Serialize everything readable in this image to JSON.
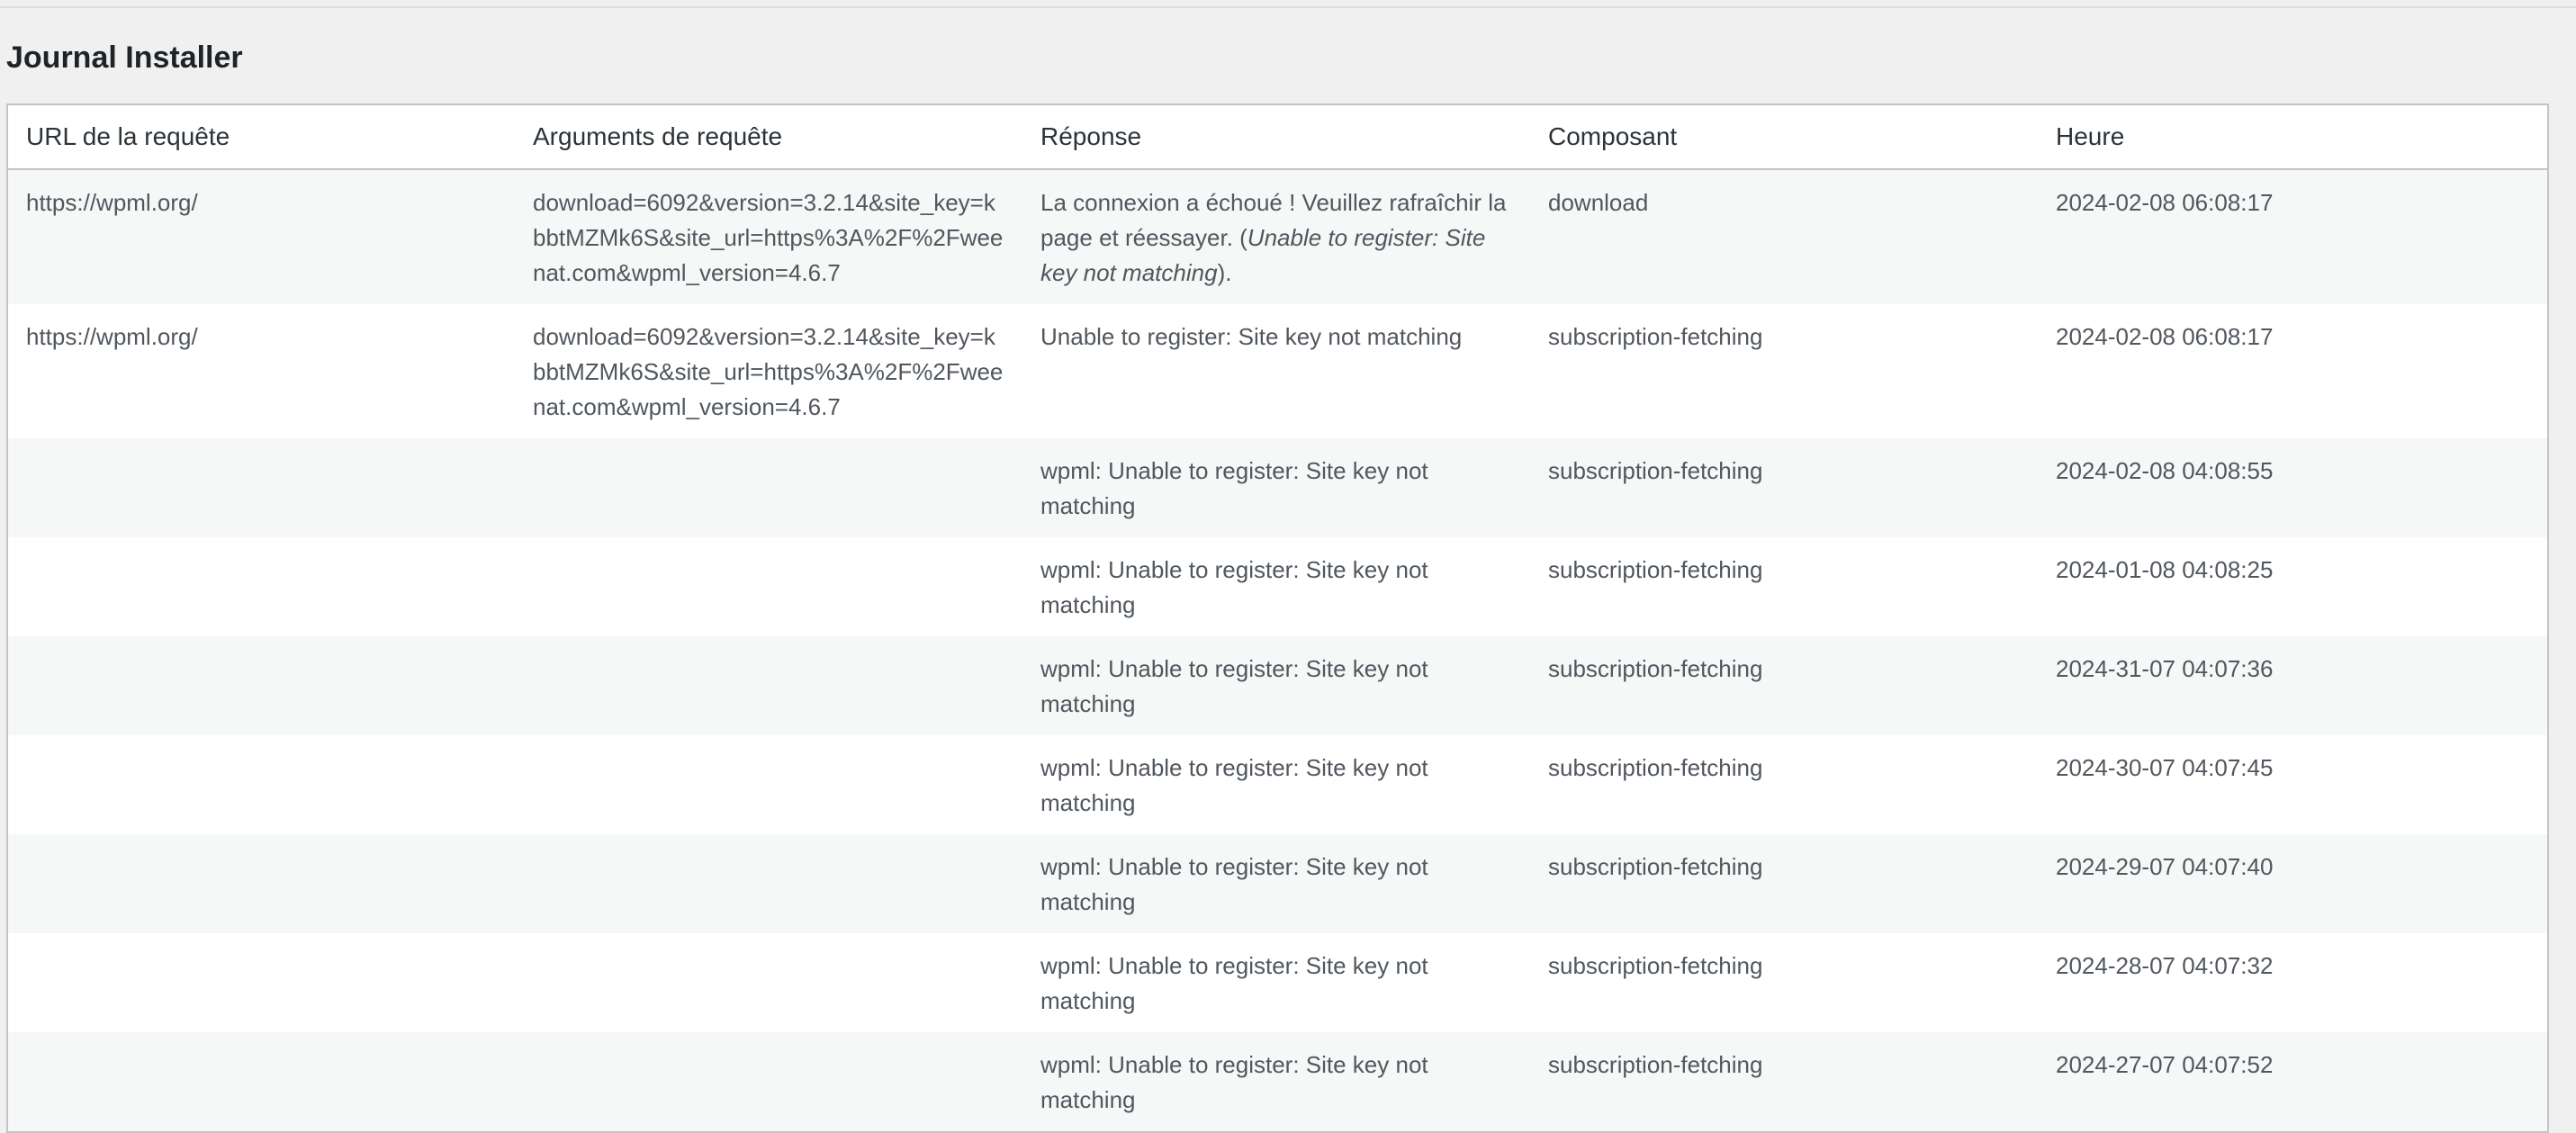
{
  "section": {
    "title": "Journal Installer"
  },
  "table": {
    "columns": [
      "URL de la requête",
      "Arguments de requête",
      "Réponse",
      "Composant",
      "Heure"
    ],
    "rows": [
      {
        "url": "https://wpml.org/",
        "args": "download=6092&version=3.2.14&site_key=kbbtMZMk6S&site_url=https%3A%2F%2Fweenat.com&wpml_version=4.6.7",
        "response_main": "La connexion a échoué ! Veuillez rafraîchir la page et réessayer. (",
        "response_italic": "Unable to register: Site key not matching",
        "response_tail": ").",
        "component": "download",
        "time": "2024-02-08 06:08:17"
      },
      {
        "url": "https://wpml.org/",
        "args": "download=6092&version=3.2.14&site_key=kbbtMZMk6S&site_url=https%3A%2F%2Fweenat.com&wpml_version=4.6.7",
        "response_main": "Unable to register: Site key not matching",
        "response_italic": "",
        "response_tail": "",
        "component": "subscription-fetching",
        "time": "2024-02-08 06:08:17"
      },
      {
        "url": "",
        "args": "",
        "response_main": "wpml: Unable to register: Site key not matching",
        "response_italic": "",
        "response_tail": "",
        "component": "subscription-fetching",
        "time": "2024-02-08 04:08:55"
      },
      {
        "url": "",
        "args": "",
        "response_main": "wpml: Unable to register: Site key not matching",
        "response_italic": "",
        "response_tail": "",
        "component": "subscription-fetching",
        "time": "2024-01-08 04:08:25"
      },
      {
        "url": "",
        "args": "",
        "response_main": "wpml: Unable to register: Site key not matching",
        "response_italic": "",
        "response_tail": "",
        "component": "subscription-fetching",
        "time": "2024-31-07 04:07:36"
      },
      {
        "url": "",
        "args": "",
        "response_main": "wpml: Unable to register: Site key not matching",
        "response_italic": "",
        "response_tail": "",
        "component": "subscription-fetching",
        "time": "2024-30-07 04:07:45"
      },
      {
        "url": "",
        "args": "",
        "response_main": "wpml: Unable to register: Site key not matching",
        "response_italic": "",
        "response_tail": "",
        "component": "subscription-fetching",
        "time": "2024-29-07 04:07:40"
      },
      {
        "url": "",
        "args": "",
        "response_main": "wpml: Unable to register: Site key not matching",
        "response_italic": "",
        "response_tail": "",
        "component": "subscription-fetching",
        "time": "2024-28-07 04:07:32"
      },
      {
        "url": "",
        "args": "",
        "response_main": "wpml: Unable to register: Site key not matching",
        "response_italic": "",
        "response_tail": "",
        "component": "subscription-fetching",
        "time": "2024-27-07 04:07:52"
      }
    ]
  },
  "colors": {
    "page_background": "#f0f0f1",
    "table_border": "#c3c4c7",
    "stripe": "#f6f7f7",
    "text": "#50575e",
    "heading": "#1d2327"
  }
}
